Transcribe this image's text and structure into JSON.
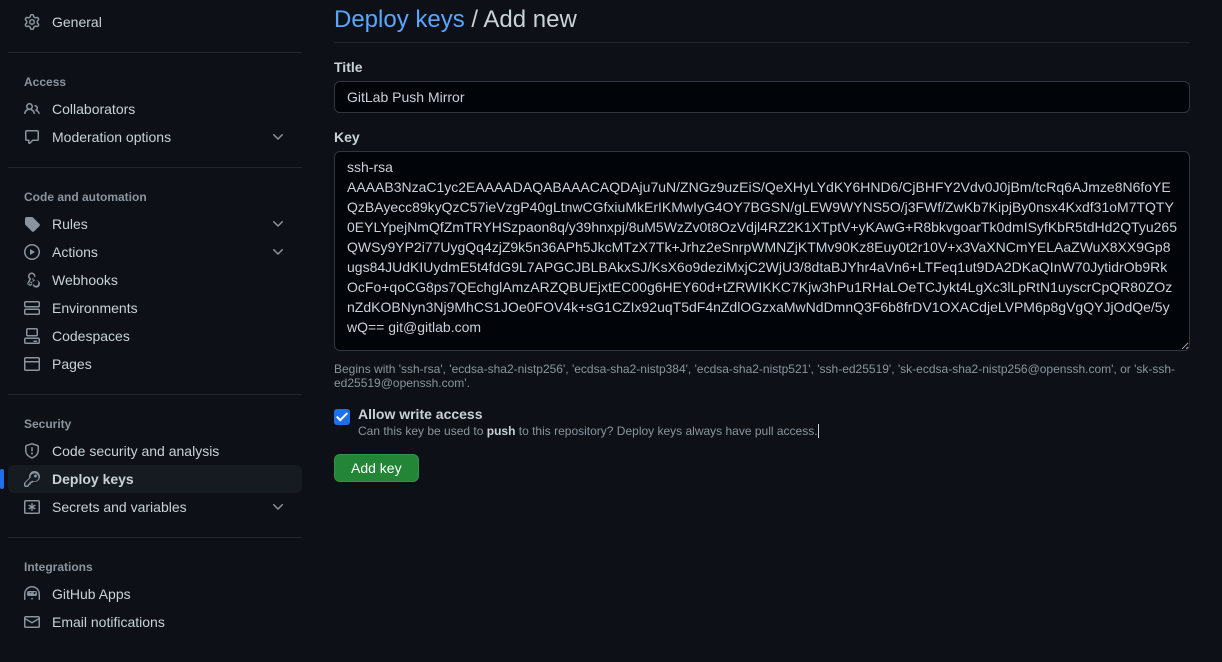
{
  "sidebar": {
    "top": {
      "general": "General"
    },
    "access": {
      "heading": "Access",
      "collaborators": "Collaborators",
      "moderation": "Moderation options"
    },
    "code": {
      "heading": "Code and automation",
      "rules": "Rules",
      "actions": "Actions",
      "webhooks": "Webhooks",
      "environments": "Environments",
      "codespaces": "Codespaces",
      "pages": "Pages"
    },
    "security": {
      "heading": "Security",
      "code_security": "Code security and analysis",
      "deploy_keys": "Deploy keys",
      "secrets": "Secrets and variables"
    },
    "integrations": {
      "heading": "Integrations",
      "github_apps": "GitHub Apps",
      "email": "Email notifications"
    }
  },
  "header": {
    "link": "Deploy keys",
    "separator": " / ",
    "current": "Add new"
  },
  "form": {
    "title_label": "Title",
    "title_value": "GitLab Push Mirror",
    "key_label": "Key",
    "key_value": "ssh-rsa AAAAB3NzaC1yc2EAAAADAQABAAACAQDAju7uN/ZNGz9uzEiS/QeXHyLYdKY6HND6/CjBHFY2Vdv0J0jBm/tcRq6AJmze8N6foYEQzBAyecc89kyQzC57ieVzgP40gLtnwCGfxiuMkErIKMwIyG4OY7BGSN/gLEW9WYNS5O/j3FWf/ZwKb7KipjBy0nsx4Kxdf31oM7TQTY0EYLYpejNmQfZmTRYHSzpaon8q/y39hnxpj/8uM5WzZv0t8OzVdjl4RZ2K1XTptV+yKAwG+R8bkvgoarTk0dmISyfKbR5tdHd2QTyu265QWSy9YP2i77UygQq4zjZ9k5n36APh5JkcMTzX7Tk+Jrhz2eSnrpWMNZjKTMv90Kz8Euy0t2r10V+x3VaXNCmYELAaZWuX8XX9Gp8ugs84JUdKIUydmE5t4fdG9L7APGCJBLBAkxSJ/KsX6o9deziMxjC2WjU3/8dtaBJYhr4aVn6+LTFeq1ut9DA2DKaQInW70JytidrOb9RkOcFo+qoCG8ps7QEchglAmzARZQBUEjxtEC00g6HEY60d+tZRWIKKC7Kjw3hPu1RHaLOeTCJykt4LgXc3lLpRtN1uyscrCpQR80ZOznZdKOBNyn3Nj9MhCS1JOe0FOV4k+sG1CZIx92uqT5dF4nZdlOGzxaMwNdDmnQ3F6b8frDV1OXACdjeLVPM6p8gVgQYJjOdQe/5ywQ== git@gitlab.com",
    "key_hint": "Begins with 'ssh-rsa', 'ecdsa-sha2-nistp256', 'ecdsa-sha2-nistp384', 'ecdsa-sha2-nistp521', 'ssh-ed25519', 'sk-ecdsa-sha2-nistp256@openssh.com', or 'sk-ssh-ed25519@openssh.com'.",
    "allow_write_label": "Allow write access",
    "allow_write_desc_1": "Can this key be used to ",
    "allow_write_desc_bold": "push",
    "allow_write_desc_2": " to this repository? Deploy keys always have pull access",
    "submit": "Add key"
  }
}
